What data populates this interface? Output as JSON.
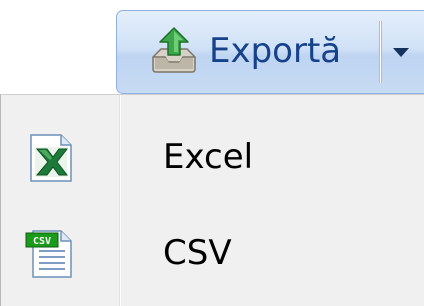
{
  "export_button": {
    "label": "Exportă",
    "icon": "export-upload-icon",
    "dropdown_icon": "caret-down-icon"
  },
  "menu": {
    "items": [
      {
        "label": "Excel",
        "icon": "excel-file-icon"
      },
      {
        "label": "CSV",
        "icon": "csv-file-icon"
      }
    ]
  },
  "colors": {
    "button_border": "#8db2e3",
    "button_text": "#15428b",
    "menu_background": "#f0f0f0",
    "excel_green": "#1d7b3a",
    "csv_green": "#1a9c1a"
  }
}
